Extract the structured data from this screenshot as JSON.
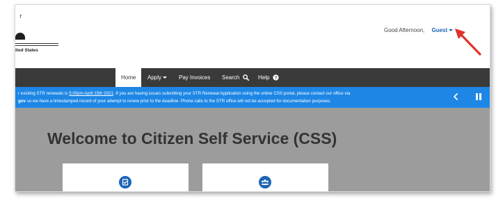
{
  "header": {
    "top_mark": "r",
    "logo_text": "ited States",
    "greeting": "Good Afternoon,",
    "user_label": "Guest"
  },
  "nav": {
    "items": [
      {
        "label": "Home",
        "active": true
      },
      {
        "label": "Apply",
        "dropdown": true
      },
      {
        "label": "Pay Invoices"
      },
      {
        "label": "Search",
        "icon": "search-icon"
      },
      {
        "label": "Help",
        "icon": "help-icon"
      }
    ]
  },
  "alert": {
    "line1_pre": "r existing STR renewals is ",
    "line1_link": "5:00pm April 15th 2021",
    "line1_post": ". If you are having issues submitting your STR Renewal Application using the online CSS portal, please contact our office via",
    "line2_bold": "gov",
    "line2_post": " so we have a timestamped record of your attempt to renew prior to the deadline. Phone calls to the STR office will not be accepted for documentation purposes."
  },
  "hero": {
    "title": "Welcome to Citizen Self Service (CSS)"
  },
  "colors": {
    "nav_bg": "#3a3a3a",
    "alert_bg": "#1e87e5",
    "hero_bg": "#9c9c9c",
    "accent": "#1c65b7",
    "annotation_arrow": "#e0322b"
  }
}
